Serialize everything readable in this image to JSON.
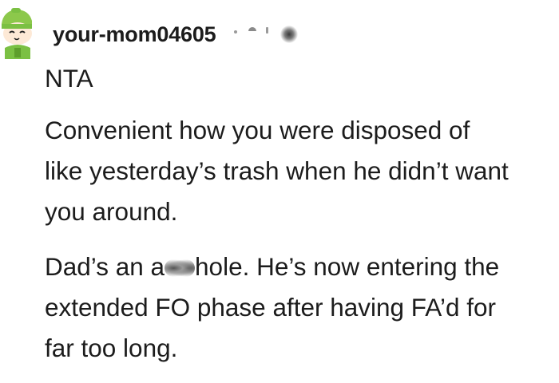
{
  "comment": {
    "author": "your-mom04605",
    "avatar_icon": "green-cartoon-avatar-icon",
    "paragraphs": {
      "p0": "NTA",
      "p1_line1": "Convenient how you were disposed of",
      "p1_line2": "like yesterday’s trash when he didn’t want",
      "p1_line3": "you around.",
      "p2_line1_before": "Dad’s an a",
      "p2_line1_after": "hole. He’s now entering the",
      "p2_line2": "extended FO phase after having FA’d for",
      "p2_line3": "far too long."
    }
  },
  "colors": {
    "text": "#1c1c1c",
    "background": "#ffffff",
    "avatar_green": "#7bc043",
    "meta_gray": "#9a9a9a"
  }
}
